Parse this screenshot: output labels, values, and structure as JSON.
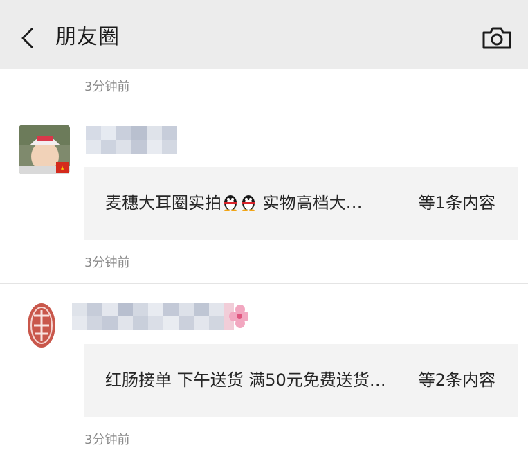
{
  "header": {
    "title": "朋友圈",
    "back_icon": "chevron-left-icon",
    "camera_icon": "camera-icon"
  },
  "feed": [
    {
      "time": "3分钟前"
    },
    {
      "content_prefix": "麦穗大耳圈实拍",
      "content_suffix": "实物高档大…",
      "emoji": [
        "penguin-emoji",
        "penguin-emoji"
      ],
      "count": "等1条内容",
      "time": "3分钟前"
    },
    {
      "content": "红肠接单 下午送货 满50元免费送货…",
      "count": "等2条内容",
      "time": "3分钟前"
    }
  ],
  "colors": {
    "header_bg": "#ececec",
    "bubble_bg": "#f3f3f3",
    "time_text": "#8a8a8a"
  }
}
